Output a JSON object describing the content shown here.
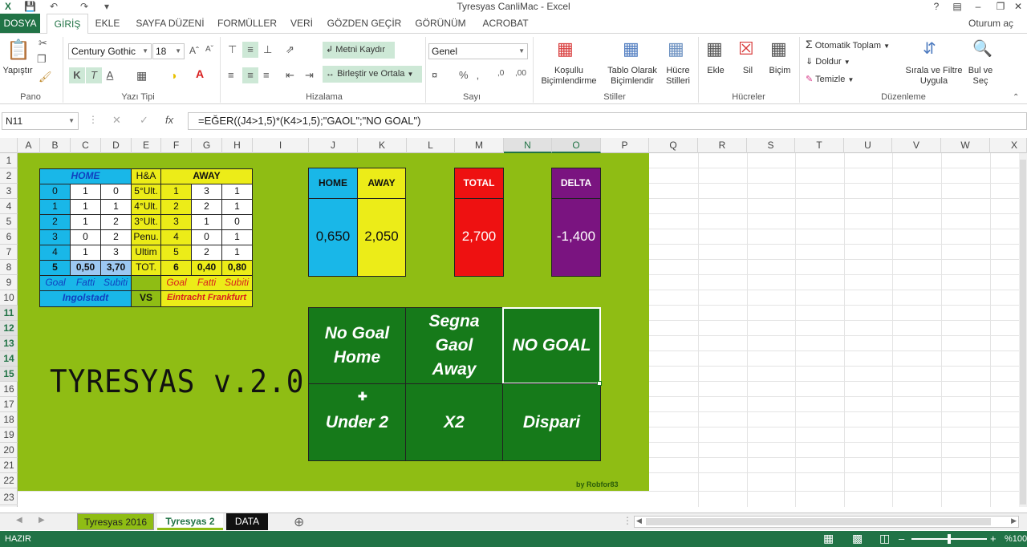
{
  "window": {
    "title": "Tyresyas CanliMac - Excel",
    "signin": "Oturum aç",
    "help": "?"
  },
  "tabs": [
    "DOSYA",
    "GİRİŞ",
    "EKLE",
    "SAYFA DÜZENİ",
    "FORMÜLLER",
    "VERİ",
    "GÖZDEN GEÇİR",
    "GÖRÜNÜM",
    "ACROBAT"
  ],
  "ribbon": {
    "paste": "Yapıştır",
    "font_name": "Century Gothic",
    "font_size": "18",
    "bold": "K",
    "italic": "T",
    "underline": "A",
    "wrap_text": "Metni Kaydır",
    "merge_center": "Birleştir ve Ortala",
    "number_format": "Genel",
    "cond_format": "Koşullu\nBiçimlendirme",
    "format_table": "Tablo Olarak\nBiçimlendir",
    "cell_styles": "Hücre\nStilleri",
    "insert": "Ekle",
    "delete": "Sil",
    "format": "Biçim",
    "autosum": "Otomatik Toplam",
    "fill": "Doldur",
    "clear": "Temizle",
    "sort_filter": "Sırala ve Filtre\nUygula",
    "find_select": "Bul ve\nSeç",
    "groups": {
      "clipboard": "Pano",
      "font": "Yazı Tipi",
      "alignment": "Hizalama",
      "number": "Sayı",
      "styles": "Stiller",
      "cells": "Hücreler",
      "editing": "Düzenleme"
    }
  },
  "formula_bar": {
    "name_box": "N11",
    "formula": "=EĞER((J4>1,5)*(K4>1,5);\"GAOL\";\"NO GOAL\")",
    "fx": "fx"
  },
  "columns": [
    "A",
    "B",
    "C",
    "D",
    "E",
    "F",
    "G",
    "H",
    "I",
    "J",
    "K",
    "L",
    "M",
    "N",
    "O",
    "P",
    "Q",
    "R",
    "S",
    "T",
    "U",
    "V",
    "W",
    "X"
  ],
  "rows": [
    "1",
    "2",
    "3",
    "4",
    "5",
    "6",
    "7",
    "8",
    "9",
    "10",
    "11",
    "12",
    "13",
    "14",
    "15",
    "16",
    "17",
    "18",
    "19",
    "20",
    "21",
    "22",
    "23"
  ],
  "table": {
    "home_header": "HOME",
    "ha_header": "H&A",
    "away_header": "AWAY",
    "rows": [
      {
        "b": "0",
        "c": "1",
        "d": "0",
        "e": "5°Ult.",
        "f": "1",
        "g": "3",
        "h": "1"
      },
      {
        "b": "1",
        "c": "1",
        "d": "1",
        "e": "4°Ult.",
        "f": "2",
        "g": "2",
        "h": "1"
      },
      {
        "b": "2",
        "c": "1",
        "d": "2",
        "e": "3°Ult.",
        "f": "3",
        "g": "1",
        "h": "0"
      },
      {
        "b": "3",
        "c": "0",
        "d": "2",
        "e": "Penu.",
        "f": "4",
        "g": "0",
        "h": "1"
      },
      {
        "b": "4",
        "c": "1",
        "d": "3",
        "e": "Ultim",
        "f": "5",
        "g": "2",
        "h": "1"
      }
    ],
    "tot": {
      "b": "5",
      "c": "0,50",
      "d": "3,70",
      "e": "TOT.",
      "f": "6",
      "g": "0,40",
      "h": "0,80"
    },
    "labels": {
      "goal": "Goal",
      "fatti": "Fatti",
      "subiti": "Subiti"
    },
    "home_team": "Ingolstadt",
    "vs": "VS",
    "away_team": "Eintracht Frankfurt"
  },
  "stats": {
    "home_label": "HOME",
    "home_value": "0,650",
    "away_label": "AWAY",
    "away_value": "2,050",
    "total_label": "TOTAL",
    "total_value": "2,700",
    "delta_label": "DELTA",
    "delta_value": "-1,400"
  },
  "predictions": {
    "p1": "No Goal\nHome",
    "p2": "Segna\nGaol\nAway",
    "p3": "NO GOAL",
    "p4": "Under 2",
    "p5": "X2",
    "p6": "Dispari"
  },
  "logo_text": "TYRESYAS v.2.0",
  "credit": "by Robfor83",
  "sheets": [
    "Tyresyas 2016",
    "Tyresyas 2",
    "DATA"
  ],
  "status": {
    "ready": "HAZIR",
    "zoom": "%100"
  },
  "colors": {
    "excel_green": "#217346",
    "sheet_bg": "#8fbd14",
    "yellow": "#ecec18",
    "cyan": "#19b7e8",
    "red": "#ee1111",
    "purple": "#7a1480",
    "dark_green": "#167a1a"
  }
}
